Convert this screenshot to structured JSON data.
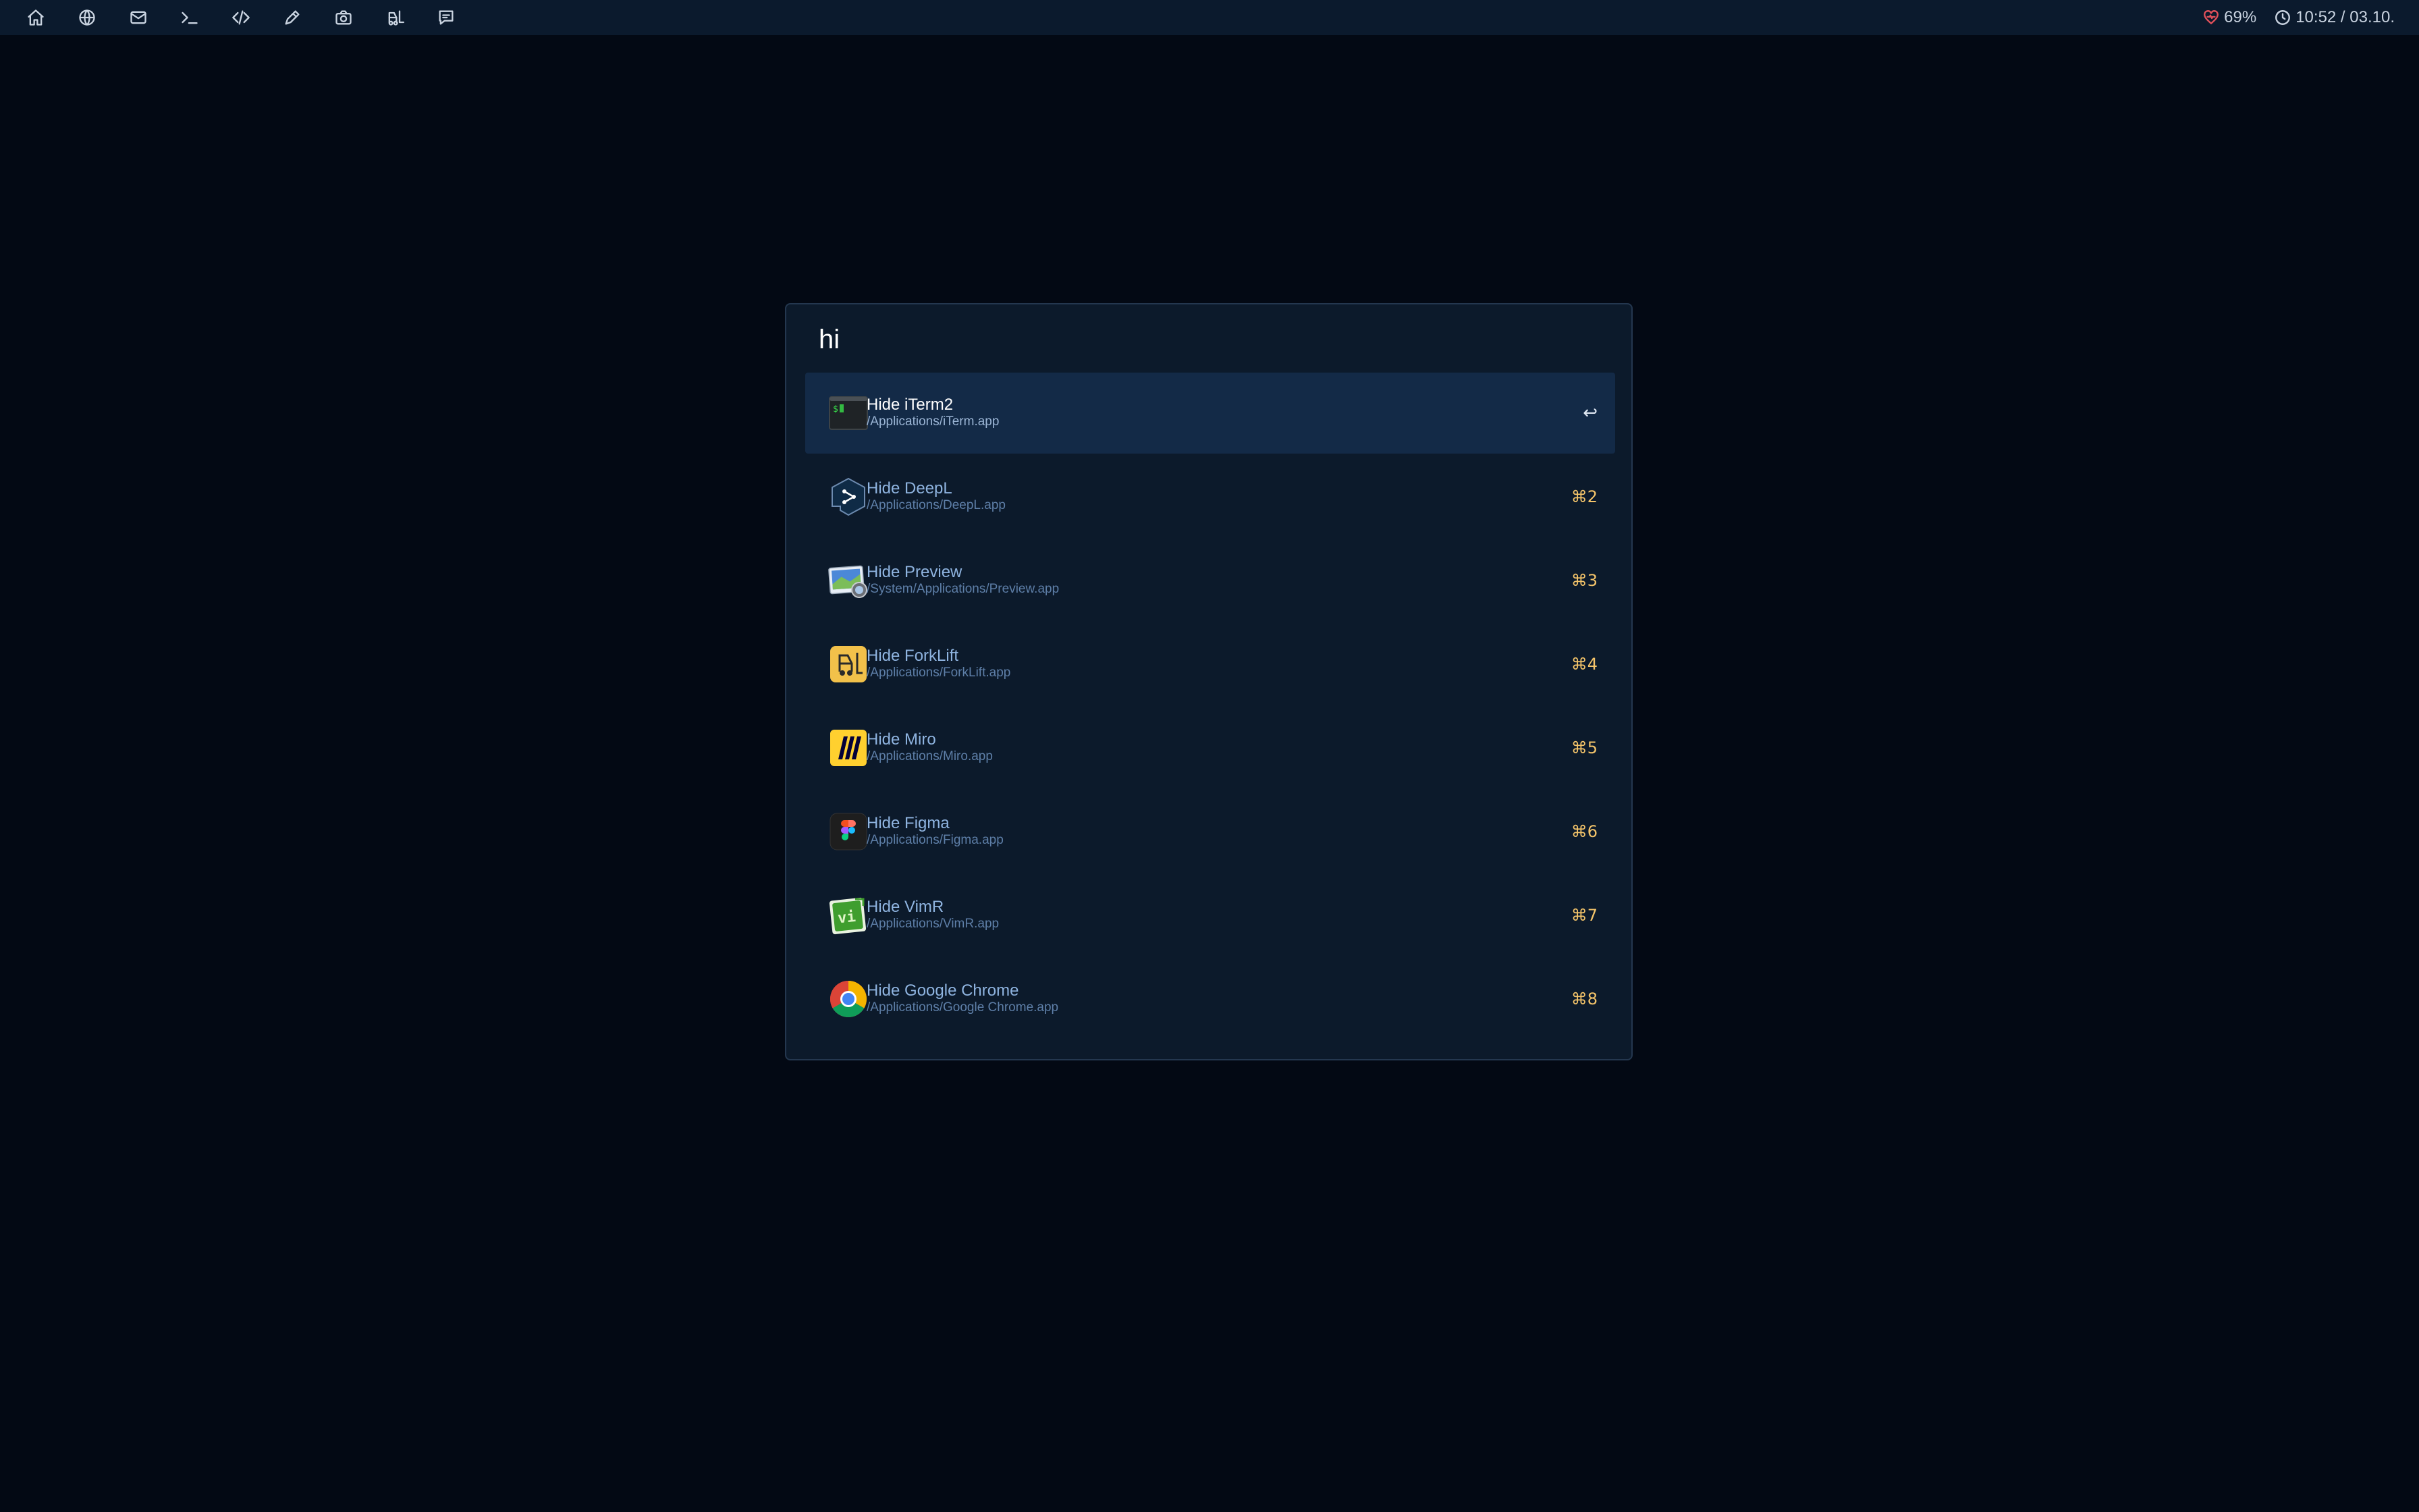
{
  "topbar": {
    "left_icons": [
      "home-icon",
      "globe-icon",
      "mail-icon",
      "terminal-icon",
      "code-icon",
      "pen-icon",
      "camera-icon",
      "forklift-icon",
      "chat-icon"
    ],
    "battery": "69%",
    "datetime": "10:52 / 03.10.",
    "battery_color": "#e0505a"
  },
  "launcher": {
    "query": "hi",
    "results": [
      {
        "title": "Hide iTerm2",
        "path": "/Applications/iTerm.app",
        "shortcut": "↩",
        "icon": "iterm-icon",
        "selected": true
      },
      {
        "title": "Hide DeepL",
        "path": "/Applications/DeepL.app",
        "shortcut": "⌘2",
        "icon": "deepl-icon"
      },
      {
        "title": "Hide Preview",
        "path": "/System/Applications/Preview.app",
        "shortcut": "⌘3",
        "icon": "preview-icon"
      },
      {
        "title": "Hide ForkLift",
        "path": "/Applications/ForkLift.app",
        "shortcut": "⌘4",
        "icon": "forklift-app-icon"
      },
      {
        "title": "Hide Miro",
        "path": "/Applications/Miro.app",
        "shortcut": "⌘5",
        "icon": "miro-icon"
      },
      {
        "title": "Hide Figma",
        "path": "/Applications/Figma.app",
        "shortcut": "⌘6",
        "icon": "figma-icon"
      },
      {
        "title": "Hide VimR",
        "path": "/Applications/VimR.app",
        "shortcut": "⌘7",
        "icon": "vimr-icon"
      },
      {
        "title": "Hide Google Chrome",
        "path": "/Applications/Google Chrome.app",
        "shortcut": "⌘8",
        "icon": "chrome-icon"
      }
    ]
  },
  "colors": {
    "background": "#030914",
    "panel": "#0c1a2b",
    "selected_row": "#132a47",
    "shortcut": "#f4c46a"
  }
}
